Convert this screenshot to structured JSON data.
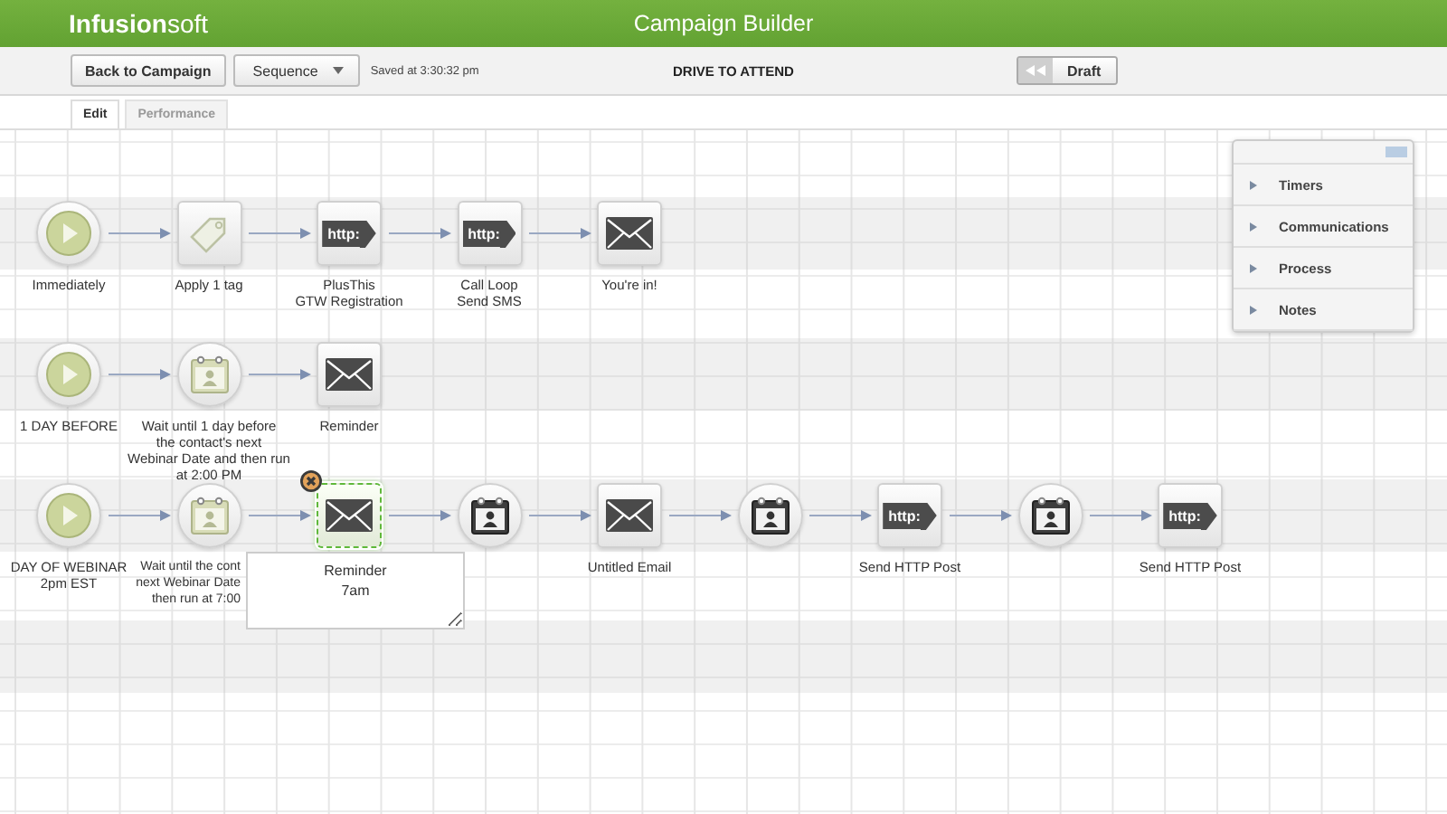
{
  "header": {
    "logo": "**Infusion**soft",
    "title": "Campaign Builder"
  },
  "toolbar": {
    "back_button": "Back to Campaign",
    "sequence_dropdown": "Sequence",
    "saved": "Saved at 3:30:32 pm",
    "campaign_name": "DRIVE TO ATTEND",
    "status": "Draft"
  },
  "tabs": [
    {
      "label": "Edit",
      "selected": true
    },
    {
      "label": "Performance",
      "selected": false
    }
  ],
  "sequences": [
    {
      "nodes": [
        {
          "kind": "start",
          "label": "Immediately",
          "selected": false
        },
        {
          "kind": "tag",
          "label": "Apply 1 tag",
          "selected": false
        },
        {
          "kind": "http",
          "badge": "http:",
          "label": "PlusThis\nGTW Registration",
          "selected": false
        },
        {
          "kind": "http",
          "badge": "http:",
          "label": "Call Loop\nSend SMS",
          "selected": false
        },
        {
          "kind": "email",
          "label": "You're in!",
          "selected": false
        }
      ]
    },
    {
      "nodes": [
        {
          "kind": "start",
          "label": "1 DAY BEFORE",
          "selected": false
        },
        {
          "kind": "date-timer",
          "label": "Wait until 1 day before\nthe contact's next\nWebinar Date and then run\nat 2:00 PM",
          "selected": false
        },
        {
          "kind": "email",
          "label": "Reminder",
          "selected": false
        }
      ]
    },
    {
      "nodes": [
        {
          "kind": "start",
          "label": "DAY OF WEBINAR\n2pm EST",
          "selected": false
        },
        {
          "kind": "date-timer",
          "label": "Wait until the cont\nnext Webinar Date\nthen run at 7:00",
          "selected": false
        },
        {
          "kind": "email",
          "editing": "Reminder\n7am",
          "selected": true
        },
        {
          "kind": "timer",
          "selected": false
        },
        {
          "kind": "email",
          "label": "Untitled Email",
          "selected": false
        },
        {
          "kind": "timer",
          "selected": false
        },
        {
          "kind": "http",
          "badge": "http:",
          "label": "Send HTTP Post",
          "selected": false
        },
        {
          "kind": "timer",
          "selected": false
        },
        {
          "kind": "http",
          "badge": "http:",
          "label": "Send HTTP Post",
          "selected": false
        }
      ]
    }
  ],
  "panel": {
    "items": [
      {
        "label": "Timers"
      },
      {
        "label": "Communications"
      },
      {
        "label": "Process"
      },
      {
        "label": "Notes"
      }
    ]
  }
}
